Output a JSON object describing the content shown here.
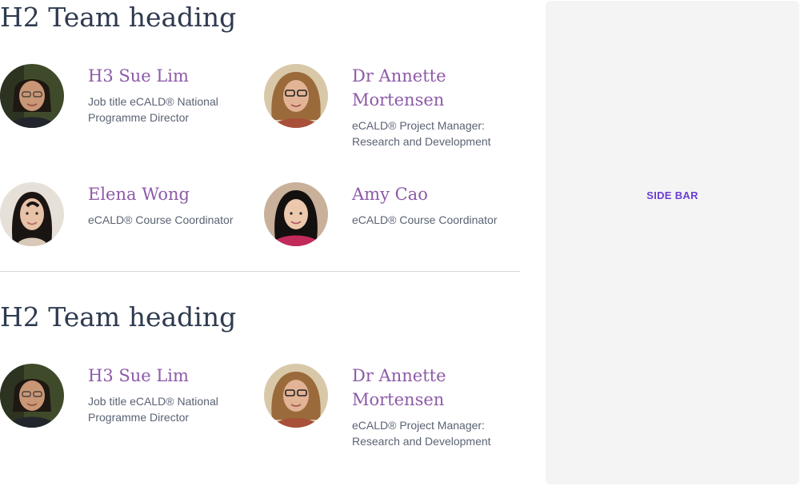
{
  "sections": [
    {
      "heading": "H2 Team heading",
      "members": [
        {
          "name": "H3 Sue Lim",
          "role": "Job title eCALD® National Programme Director",
          "photo": "sue-lim-photo"
        },
        {
          "name": "Dr Annette Mortensen",
          "role": "eCALD® Project Manager: Research and Development",
          "photo": "annette-mortensen-photo"
        },
        {
          "name": "Elena Wong",
          "role": "eCALD® Course Coordinator",
          "photo": "elena-wong-photo"
        },
        {
          "name": "Amy Cao",
          "role": "eCALD® Course Coordinator",
          "photo": "amy-cao-photo"
        }
      ]
    },
    {
      "heading": "H2 Team heading",
      "members": [
        {
          "name": "H3 Sue Lim",
          "role": "Job title eCALD® National Programme Director",
          "photo": "sue-lim-photo"
        },
        {
          "name": "Dr Annette Mortensen",
          "role": "eCALD® Project Manager: Research and Development",
          "photo": "annette-mortensen-photo"
        }
      ]
    }
  ],
  "sidebar": {
    "label": "SIDE BAR"
  },
  "colors": {
    "heading": "#2e3a4f",
    "name": "#8d5aa8",
    "role": "#5a6373",
    "sidebar_bg": "#f4f4f4",
    "sidebar_label": "#6a3fd1",
    "divider": "#d6d6d6"
  }
}
